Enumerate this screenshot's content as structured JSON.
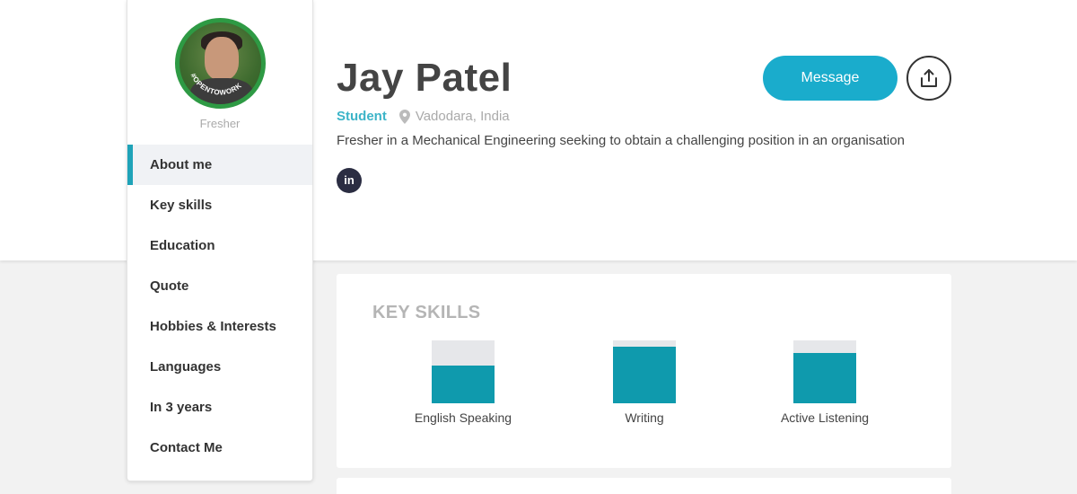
{
  "profile": {
    "name": "Jay Patel",
    "caption": "Fresher",
    "status": "Student",
    "location": "Vadodara, India",
    "summary": "Fresher in a Mechanical Engineering seeking to obtain a challenging position in an organisation",
    "avatar_ring_text": "#OPENTOWORK",
    "linkedin_label": "in"
  },
  "nav": {
    "items": [
      {
        "label": "About me",
        "active": true
      },
      {
        "label": "Key skills"
      },
      {
        "label": "Education"
      },
      {
        "label": "Quote"
      },
      {
        "label": "Hobbies & Interests"
      },
      {
        "label": "Languages"
      },
      {
        "label": "In 3 years"
      },
      {
        "label": "Contact Me"
      }
    ]
  },
  "actions": {
    "message_label": "Message",
    "share_icon": "share-icon"
  },
  "skills": {
    "title": "KEY SKILLS",
    "items": [
      {
        "label": "English Speaking",
        "level": 0.6
      },
      {
        "label": "Writing",
        "level": 0.9
      },
      {
        "label": "Active Listening",
        "level": 0.8
      }
    ]
  },
  "colors": {
    "accent": "#1aaccc",
    "bar": "#0f9aad",
    "status": "#3cb4c8"
  }
}
